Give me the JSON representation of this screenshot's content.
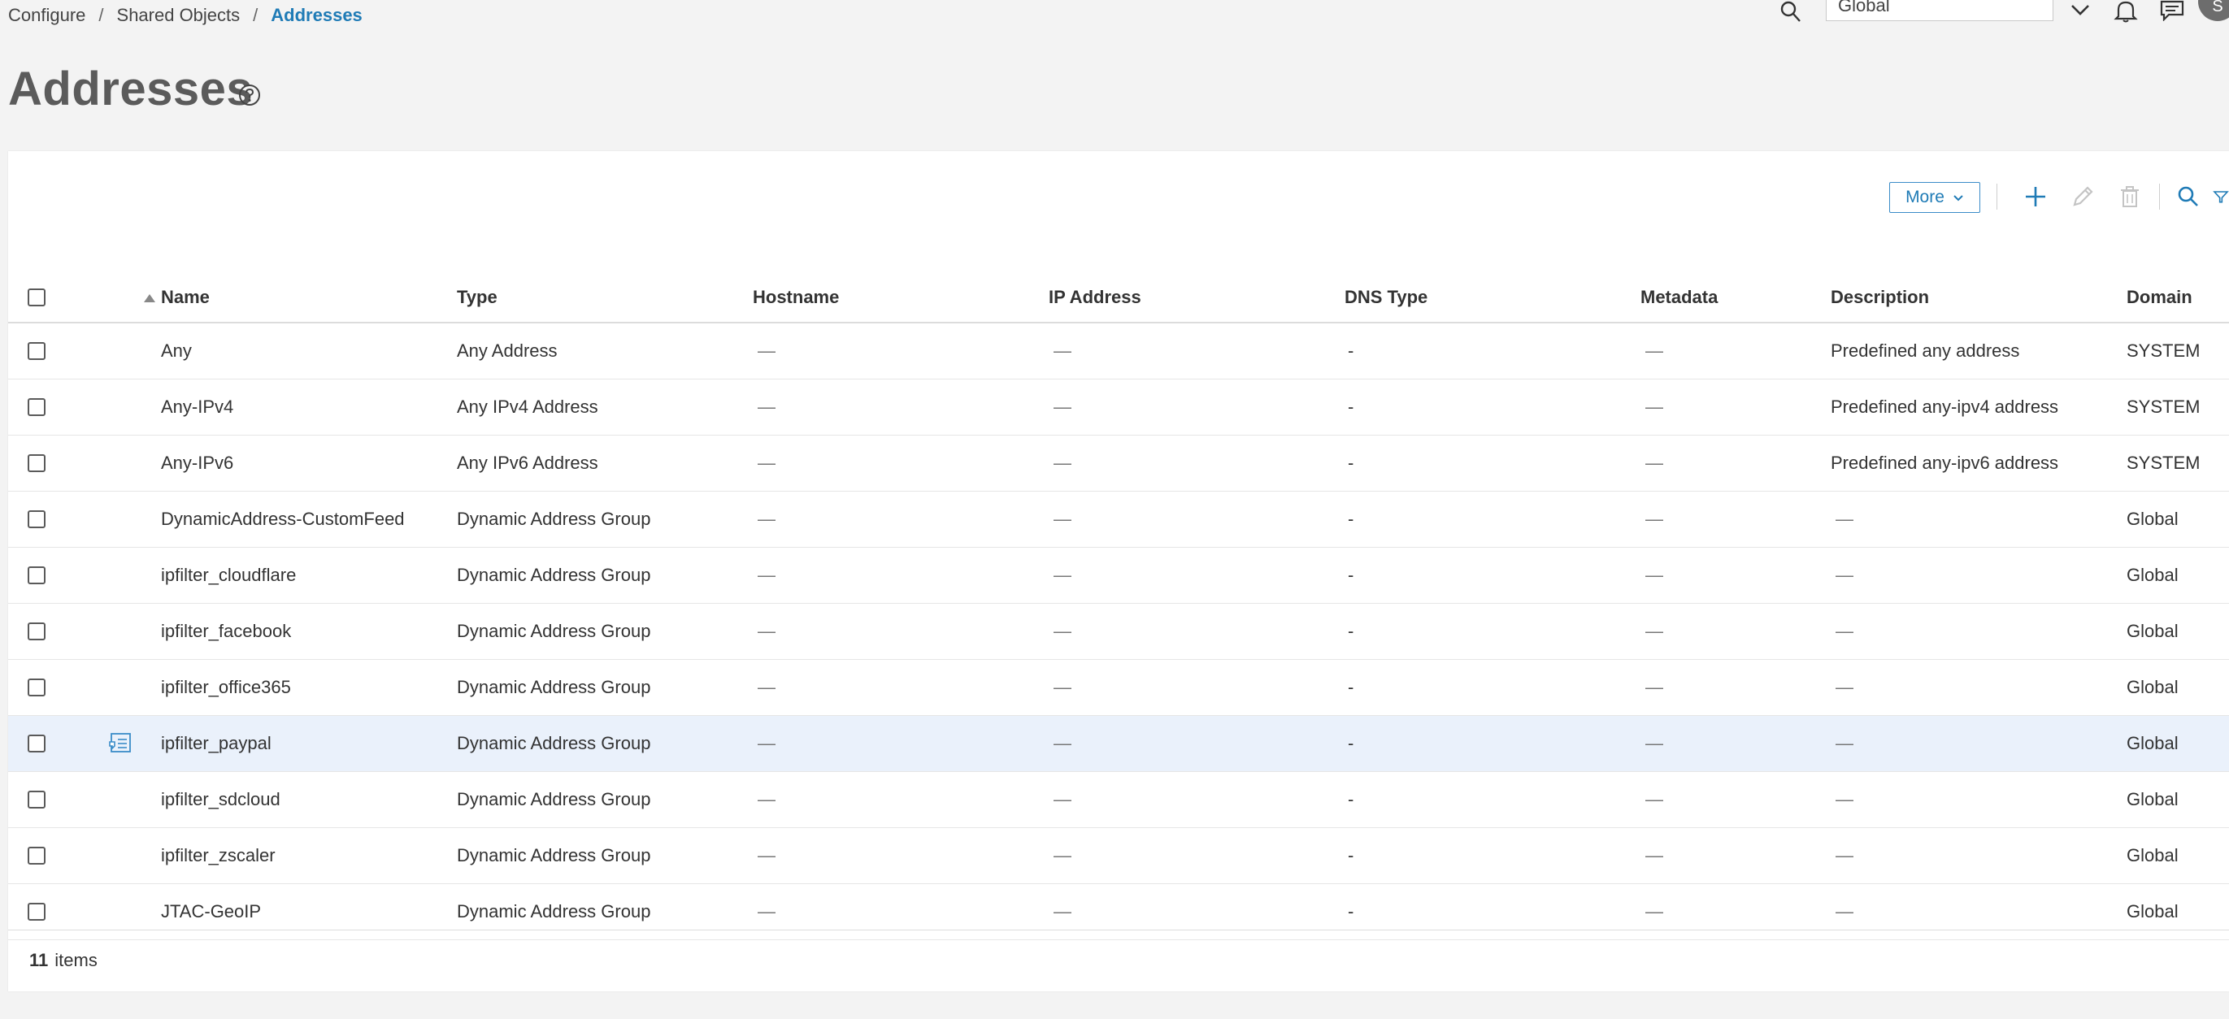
{
  "breadcrumb": {
    "items": [
      "Configure",
      "Shared Objects"
    ],
    "current": "Addresses",
    "separator": "/"
  },
  "header": {
    "domain_value": "Global",
    "avatar_initial": "S"
  },
  "page": {
    "title": "Addresses"
  },
  "toolbar": {
    "more_label": "More"
  },
  "table": {
    "columns": [
      "Name",
      "Type",
      "Hostname",
      "IP Address",
      "DNS Type",
      "Metadata",
      "Description",
      "Domain"
    ],
    "rows": [
      {
        "name": "Any",
        "type": "Any Address",
        "hostname": "—",
        "ip": "—",
        "dns": "-",
        "metadata": "—",
        "description": "Predefined any address",
        "domain": "SYSTEM"
      },
      {
        "name": "Any-IPv4",
        "type": "Any IPv4 Address",
        "hostname": "—",
        "ip": "—",
        "dns": "-",
        "metadata": "—",
        "description": "Predefined any-ipv4 address",
        "domain": "SYSTEM"
      },
      {
        "name": "Any-IPv6",
        "type": "Any IPv6 Address",
        "hostname": "—",
        "ip": "—",
        "dns": "-",
        "metadata": "—",
        "description": "Predefined any-ipv6 address",
        "domain": "SYSTEM"
      },
      {
        "name": "DynamicAddress-CustomFeed",
        "type": "Dynamic Address Group",
        "hostname": "—",
        "ip": "—",
        "dns": "-",
        "metadata": "—",
        "description": "—",
        "domain": "Global"
      },
      {
        "name": "ipfilter_cloudflare",
        "type": "Dynamic Address Group",
        "hostname": "—",
        "ip": "—",
        "dns": "-",
        "metadata": "—",
        "description": "—",
        "domain": "Global"
      },
      {
        "name": "ipfilter_facebook",
        "type": "Dynamic Address Group",
        "hostname": "—",
        "ip": "—",
        "dns": "-",
        "metadata": "—",
        "description": "—",
        "domain": "Global"
      },
      {
        "name": "ipfilter_office365",
        "type": "Dynamic Address Group",
        "hostname": "—",
        "ip": "—",
        "dns": "-",
        "metadata": "—",
        "description": "—",
        "domain": "Global"
      },
      {
        "name": "ipfilter_paypal",
        "type": "Dynamic Address Group",
        "hostname": "—",
        "ip": "—",
        "dns": "-",
        "metadata": "—",
        "description": "—",
        "domain": "Global"
      },
      {
        "name": "ipfilter_sdcloud",
        "type": "Dynamic Address Group",
        "hostname": "—",
        "ip": "—",
        "dns": "-",
        "metadata": "—",
        "description": "—",
        "domain": "Global"
      },
      {
        "name": "ipfilter_zscaler",
        "type": "Dynamic Address Group",
        "hostname": "—",
        "ip": "—",
        "dns": "-",
        "metadata": "—",
        "description": "—",
        "domain": "Global"
      },
      {
        "name": "JTAC-GeoIP",
        "type": "Dynamic Address Group",
        "hostname": "—",
        "ip": "—",
        "dns": "-",
        "metadata": "—",
        "description": "—",
        "domain": "Global"
      }
    ]
  },
  "footer": {
    "count": "11",
    "label": "items"
  },
  "colors": {
    "accent": "#1f7bb6",
    "highlight_row": "#eaf1fb",
    "icons": [
      "search-icon",
      "chevron-down-icon",
      "bell-icon",
      "chat-icon",
      "help-icon",
      "plus-icon",
      "pencil-icon",
      "trash-icon",
      "filter-icon",
      "sort-ascending-icon",
      "details-icon"
    ]
  }
}
